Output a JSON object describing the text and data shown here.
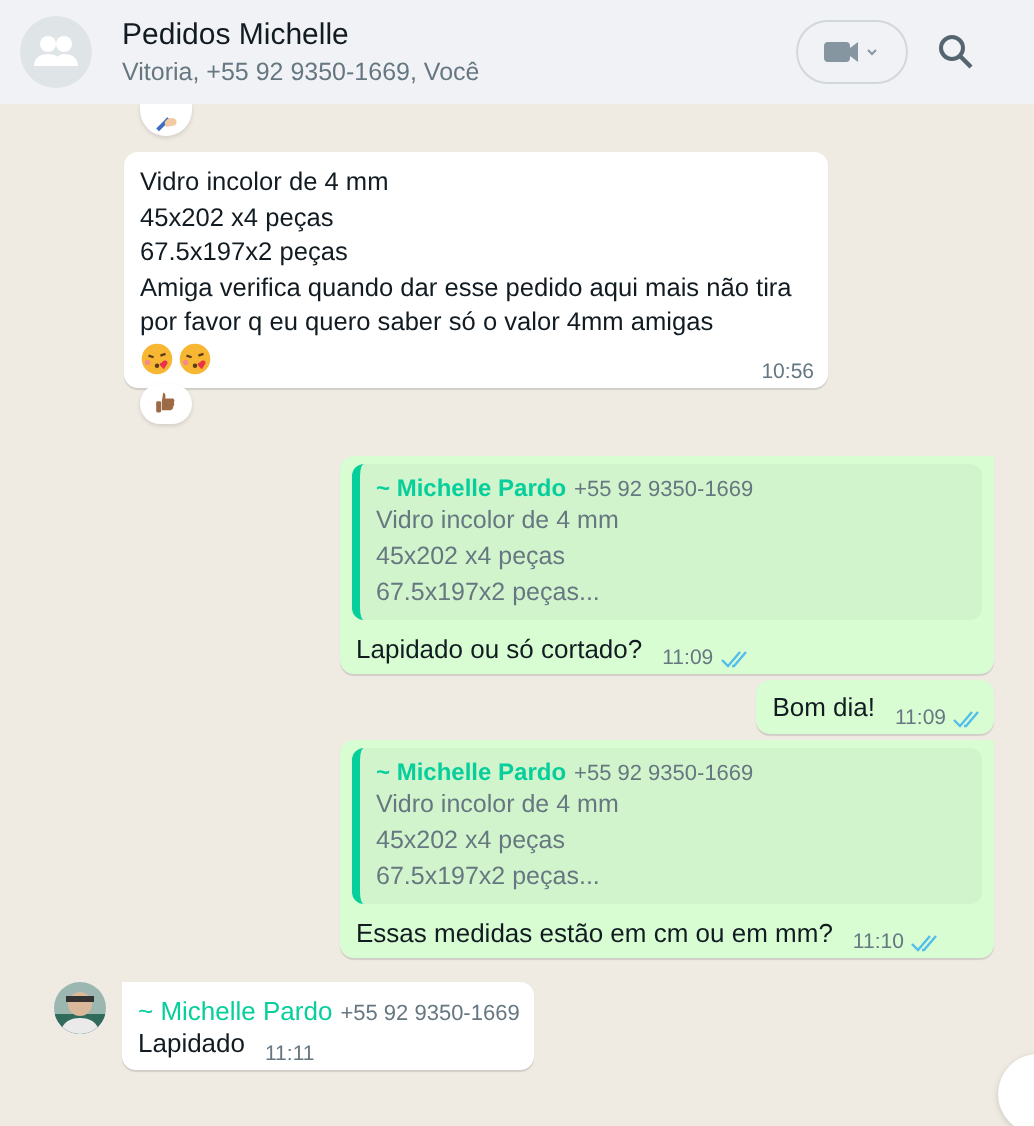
{
  "header": {
    "title": "Pedidos Michelle",
    "subtitle": "Vitoria, +55 92 9350-1669, Você"
  },
  "messages": [
    {
      "kind": "reaction_only",
      "reaction": {
        "kind": "writing-hand"
      }
    },
    {
      "kind": "incoming",
      "lines": [
        "Vidro incolor de 4 mm",
        "45x202 x4 peças",
        "67.5x197x2 peças",
        "Amiga verifica quando dar esse pedido aqui mais não tira por favor q eu quero saber só o valor 4mm amigas"
      ],
      "emojis": [
        {
          "kind": "kiss"
        },
        {
          "kind": "kiss"
        }
      ],
      "time": "10:56",
      "reaction": {
        "kind": "thumbs-up"
      }
    },
    {
      "kind": "outgoing",
      "quote": {
        "author": "~ Michelle Pardo",
        "phone": "+55 92 9350-1669",
        "lines": [
          "Vidro incolor de 4 mm",
          "45x202 x4 peças",
          "67.5x197x2 peças..."
        ]
      },
      "lines": [
        "Lapidado ou só cortado?"
      ],
      "time": "11:09",
      "read": true,
      "tail": true
    },
    {
      "kind": "outgoing",
      "lines": [
        "Bom dia!"
      ],
      "time": "11:09",
      "read": true,
      "tail": false
    },
    {
      "kind": "outgoing",
      "quote": {
        "author": "~ Michelle Pardo",
        "phone": "+55 92 9350-1669",
        "lines": [
          "Vidro incolor de 4 mm",
          "45x202 x4 peças",
          "67.5x197x2 peças..."
        ]
      },
      "lines": [
        "Essas medidas estão em cm ou em mm?"
      ],
      "time": "11:10",
      "read": true,
      "tail": true
    },
    {
      "kind": "incoming",
      "avatar": true,
      "author": "~ Michelle Pardo",
      "phone": "+55 92 9350-1669",
      "lines": [
        "Lapidado"
      ],
      "time": "11:11"
    }
  ]
}
